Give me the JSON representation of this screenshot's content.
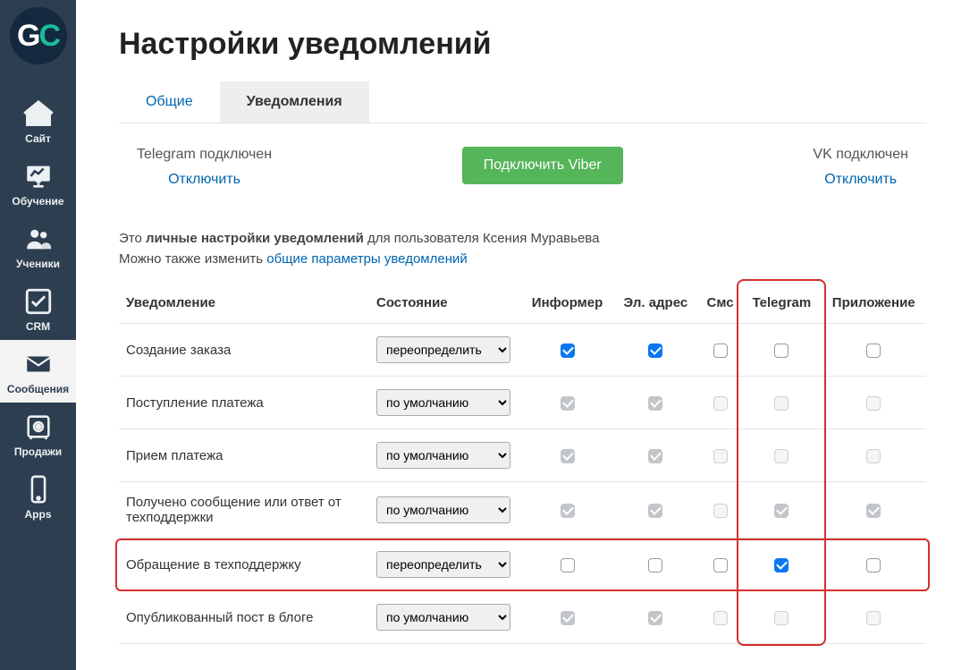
{
  "logo": {
    "g": "G",
    "c": "C"
  },
  "sidebar": {
    "items": [
      {
        "label": "Сайт",
        "icon": "home-icon"
      },
      {
        "label": "Обучение",
        "icon": "chart-icon"
      },
      {
        "label": "Ученики",
        "icon": "users-icon"
      },
      {
        "label": "CRM",
        "icon": "check-icon"
      },
      {
        "label": "Сообщения",
        "icon": "mail-icon",
        "active": true
      },
      {
        "label": "Продажи",
        "icon": "safe-icon"
      },
      {
        "label": "Apps",
        "icon": "phone-icon"
      }
    ]
  },
  "header": {
    "title": "Настройки уведомлений"
  },
  "tabs": [
    {
      "label": "Общие",
      "active": false
    },
    {
      "label": "Уведомления",
      "active": true
    }
  ],
  "connections": {
    "telegram": {
      "status": "Telegram подключен",
      "action": "Отключить"
    },
    "viber": {
      "button": "Подключить Viber"
    },
    "vk": {
      "status": "VK подключен",
      "action": "Отключить"
    }
  },
  "intro": {
    "prefix": "Это ",
    "bold": "личные настройки уведомлений",
    "middle": " для пользователя Ксения Муравьева",
    "line2_prefix": "Можно также изменить ",
    "link": "общие параметры уведомлений"
  },
  "table": {
    "headers": {
      "notification": "Уведомление",
      "state": "Состояние",
      "informer": "Информер",
      "email": "Эл. адрес",
      "sms": "Смс",
      "telegram": "Telegram",
      "app": "Приложение"
    },
    "state_options": {
      "override": "переопределить",
      "default": "по умолчанию"
    },
    "rows": [
      {
        "name": "Создание заказа",
        "state": "override",
        "informer": "on",
        "email": "on",
        "sms": "off",
        "telegram": "off",
        "app": "off"
      },
      {
        "name": "Поступление платежа",
        "state": "default",
        "informer": "d_on",
        "email": "d_on",
        "sms": "d_off",
        "telegram": "d_off",
        "app": "d_off"
      },
      {
        "name": "Прием платежа",
        "state": "default",
        "informer": "d_on",
        "email": "d_on",
        "sms": "d_off",
        "telegram": "d_off",
        "app": "d_off"
      },
      {
        "name": "Получено сообщение или ответ от техподдержки",
        "state": "default",
        "informer": "d_on",
        "email": "d_on",
        "sms": "d_off",
        "telegram": "d_on",
        "app": "d_on"
      },
      {
        "name": "Обращение в техподдержку",
        "state": "override",
        "informer": "off",
        "email": "off",
        "sms": "off",
        "telegram": "on",
        "app": "off",
        "highlight_row": true
      },
      {
        "name": "Опубликованный пост в блоге",
        "state": "default",
        "informer": "d_on",
        "email": "d_on",
        "sms": "d_off",
        "telegram": "d_off",
        "app": "d_off"
      }
    ]
  }
}
